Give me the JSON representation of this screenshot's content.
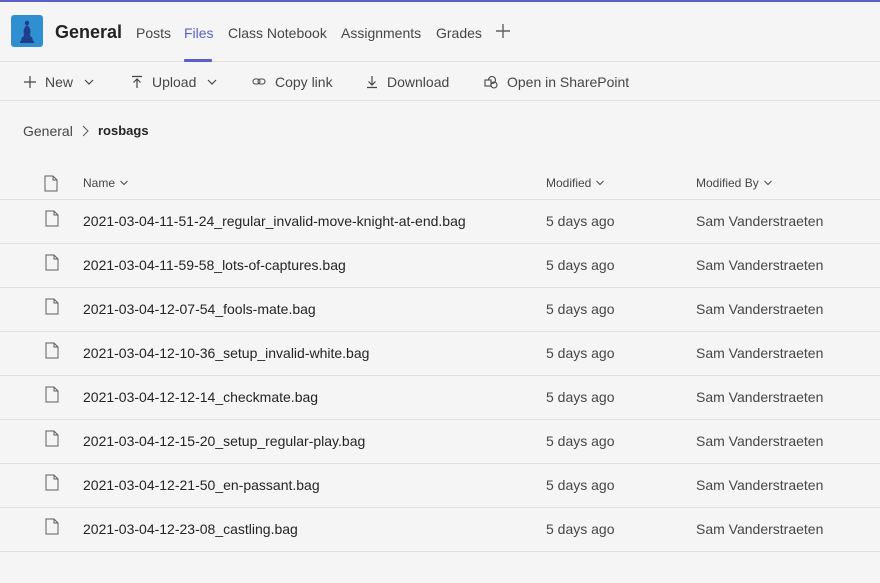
{
  "header": {
    "channel_name": "General",
    "tabs": [
      {
        "label": "Posts"
      },
      {
        "label": "Files"
      },
      {
        "label": "Class Notebook"
      },
      {
        "label": "Assignments"
      },
      {
        "label": "Grades"
      }
    ],
    "active_tab": "Files"
  },
  "toolbar": {
    "new_label": "New",
    "upload_label": "Upload",
    "copy_link_label": "Copy link",
    "download_label": "Download",
    "open_sharepoint_label": "Open in SharePoint"
  },
  "breadcrumb": {
    "root": "General",
    "current": "rosbags"
  },
  "table": {
    "columns": {
      "name": "Name",
      "modified": "Modified",
      "modified_by": "Modified By"
    },
    "rows": [
      {
        "name": "2021-03-04-11-51-24_regular_invalid-move-knight-at-end.bag",
        "modified": "5 days ago",
        "modified_by": "Sam Vanderstraeten"
      },
      {
        "name": "2021-03-04-11-59-58_lots-of-captures.bag",
        "modified": "5 days ago",
        "modified_by": "Sam Vanderstraeten"
      },
      {
        "name": "2021-03-04-12-07-54_fools-mate.bag",
        "modified": "5 days ago",
        "modified_by": "Sam Vanderstraeten"
      },
      {
        "name": "2021-03-04-12-10-36_setup_invalid-white.bag",
        "modified": "5 days ago",
        "modified_by": "Sam Vanderstraeten"
      },
      {
        "name": "2021-03-04-12-12-14_checkmate.bag",
        "modified": "5 days ago",
        "modified_by": "Sam Vanderstraeten"
      },
      {
        "name": "2021-03-04-12-15-20_setup_regular-play.bag",
        "modified": "5 days ago",
        "modified_by": "Sam Vanderstraeten"
      },
      {
        "name": "2021-03-04-12-21-50_en-passant.bag",
        "modified": "5 days ago",
        "modified_by": "Sam Vanderstraeten"
      },
      {
        "name": "2021-03-04-12-23-08_castling.bag",
        "modified": "5 days ago",
        "modified_by": "Sam Vanderstraeten"
      }
    ]
  },
  "colors": {
    "accent": "#5b5fc7",
    "background": "#f5f5f5",
    "divider": "#e1dfdd"
  }
}
